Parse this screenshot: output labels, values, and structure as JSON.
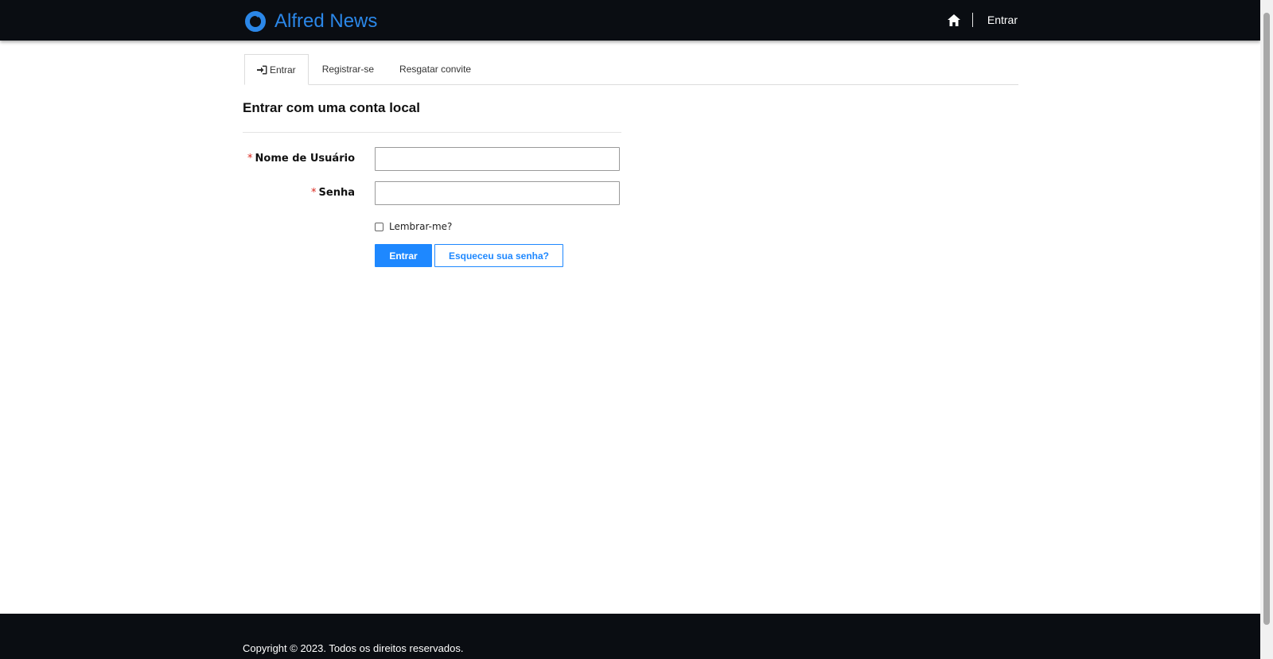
{
  "header": {
    "brand_name": "Alfred News",
    "login_label": "Entrar",
    "home_icon": "home-icon"
  },
  "tabs": [
    {
      "label": "Entrar",
      "active": true,
      "icon": "sign-in-icon"
    },
    {
      "label": "Registrar-se",
      "active": false
    },
    {
      "label": "Resgatar convite",
      "active": false
    }
  ],
  "form": {
    "title": "Entrar com uma conta local",
    "username_label": "Nome de Usuário",
    "password_label": "Senha",
    "required_marker": "*",
    "username_value": "",
    "password_value": "",
    "remember_label": "Lembrar-me?",
    "remember_checked": false,
    "submit_label": "Entrar",
    "forgot_label": "Esqueceu sua senha?"
  },
  "footer": {
    "copyright": "Copyright © 2023. Todos os direitos reservados."
  },
  "colors": {
    "brand": "#2b87e8",
    "primary": "#1e88ff",
    "header_bg": "#0a0d12",
    "required": "#d9261c"
  }
}
